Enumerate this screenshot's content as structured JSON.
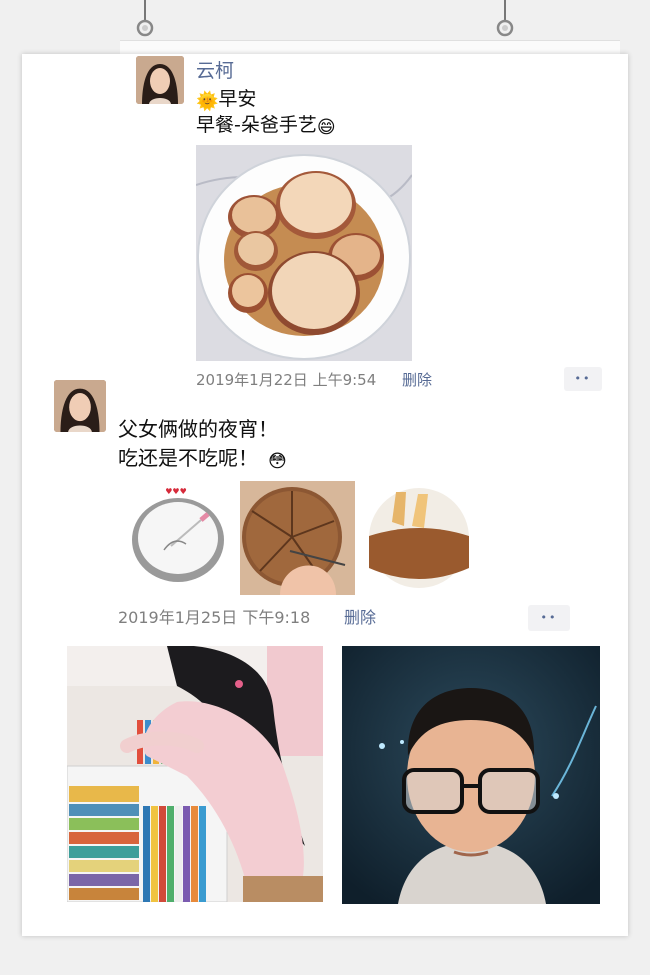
{
  "post1": {
    "name": "云柯",
    "line1_emoji": "🌞",
    "line1": "早安",
    "line2": "早餐-朵爸手艺",
    "line2_emoji": "😄",
    "time": "2019年1月22日 上午9:54",
    "delete": "删除",
    "more": "••"
  },
  "post2": {
    "line1": "父女俩做的夜宵！",
    "line2": "吃还是不吃呢！",
    "line2_emoji": "😳",
    "time": "2019年1月25日 下午9:18",
    "delete": "删除",
    "more": "••"
  },
  "colors": {
    "name_blue": "#576b95",
    "meta_gray": "#7f7f7f",
    "more_bg": "#f2f2f4"
  },
  "icons": [
    "hanging-hook-icon",
    "more-dots-icon",
    "sun-emoji-icon",
    "grin-emoji-icon",
    "flushed-emoji-icon"
  ]
}
